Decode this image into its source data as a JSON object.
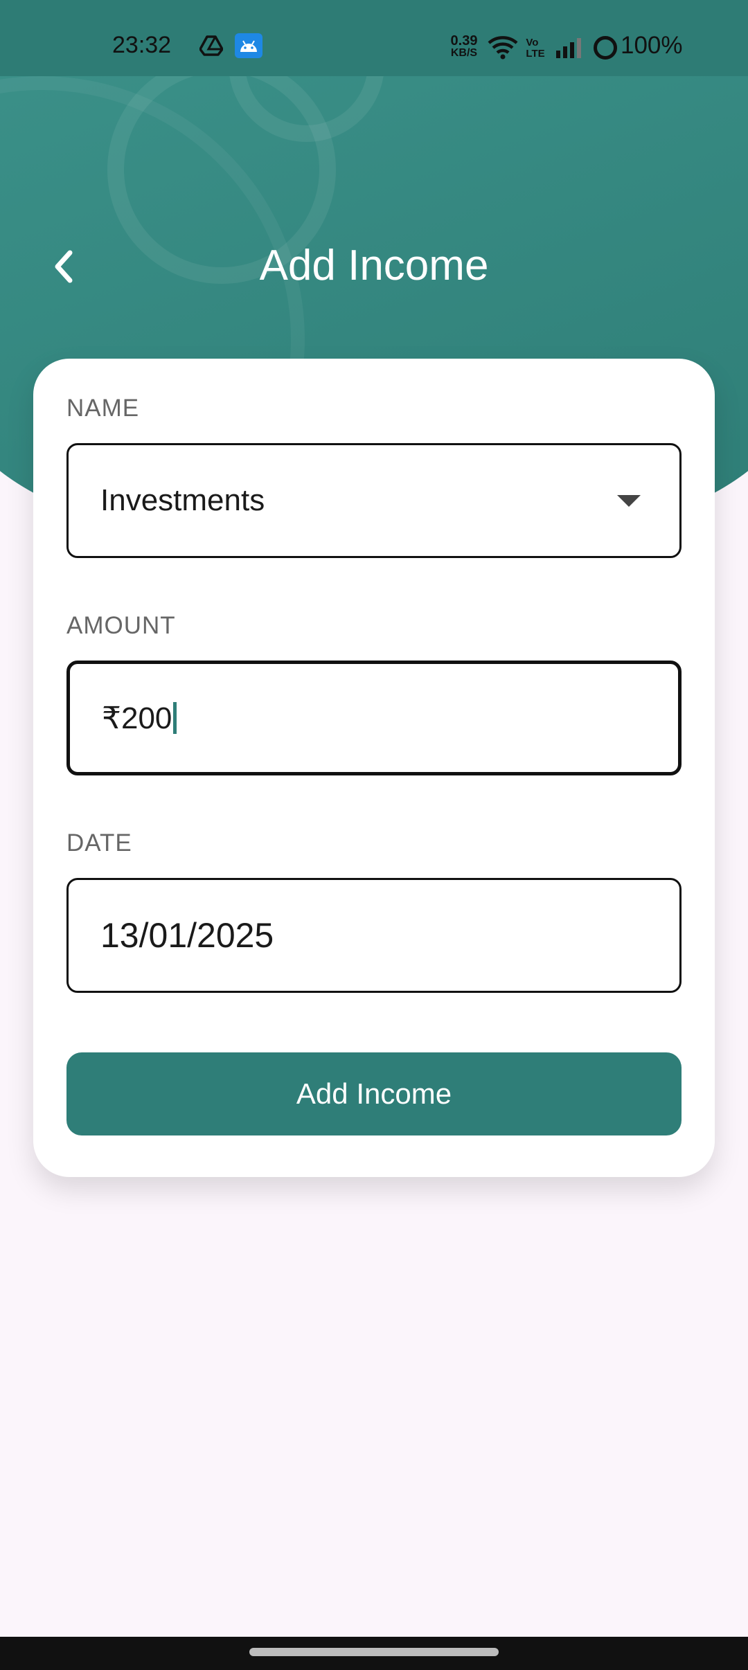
{
  "status_bar": {
    "time": "23:32",
    "net_speed_value": "0.39",
    "net_speed_unit": "KB/S",
    "volte": "Vo LTE",
    "battery": "100%",
    "icons": [
      "drive-icon",
      "android-icon",
      "wifi-icon",
      "signal-icon",
      "battery-icon"
    ]
  },
  "header": {
    "title": "Add Income",
    "back_icon": "chevron-left-icon"
  },
  "form": {
    "name": {
      "label": "NAME",
      "value": "Investments",
      "icon": "dropdown-arrow-icon"
    },
    "amount": {
      "label": "AMOUNT",
      "value": "₹200"
    },
    "date": {
      "label": "DATE",
      "value": "13/01/2025"
    },
    "submit_label": "Add Income"
  },
  "colors": {
    "accent": "#2f7e78",
    "header": "#3e958d",
    "background": "#fbf5fb"
  }
}
